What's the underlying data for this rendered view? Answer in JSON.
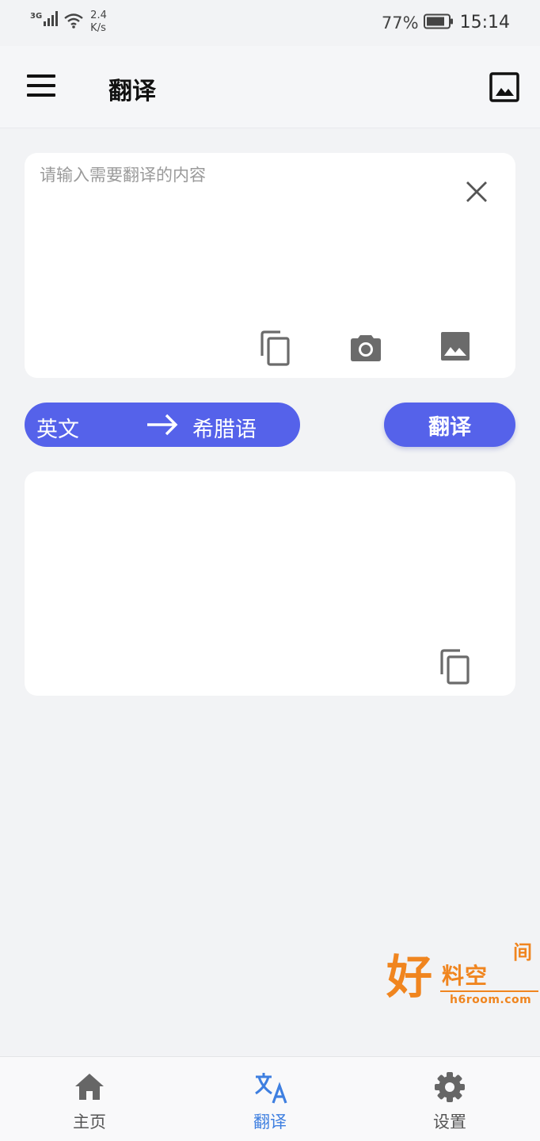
{
  "status_bar": {
    "network_type": "3G",
    "net_speed_value": "2.4",
    "net_speed_unit": "K/s",
    "battery_percent": "77%",
    "time": "15:14"
  },
  "app_bar": {
    "title": "翻译",
    "menu_icon": "hamburger-menu-icon",
    "image_icon": "image-icon"
  },
  "input_card": {
    "placeholder": "请输入需要翻译的内容",
    "value": "",
    "icons": [
      "close-icon",
      "copy-icon",
      "camera-icon",
      "image-icon"
    ]
  },
  "language": {
    "source": "英文",
    "target": "希腊语",
    "arrow_icon": "arrow-right-icon"
  },
  "translate_button": {
    "label": "翻译"
  },
  "output_card": {
    "text": "",
    "icons": [
      "copy-icon"
    ]
  },
  "watermark": {
    "char_big": "好",
    "chars_mid": "料空",
    "char_top": "间",
    "url": "h6room.com"
  },
  "bottom_nav": {
    "items": [
      {
        "label": "主页",
        "icon": "home-icon",
        "active": false
      },
      {
        "label": "翻译",
        "icon": "translate-icon",
        "active": true
      },
      {
        "label": "设置",
        "icon": "gear-icon",
        "active": false
      }
    ]
  },
  "colors": {
    "accent": "#5562ea",
    "active_nav": "#3e7fe0",
    "background": "#f2f3f5",
    "card": "#ffffff",
    "watermark": "#f0851f"
  }
}
